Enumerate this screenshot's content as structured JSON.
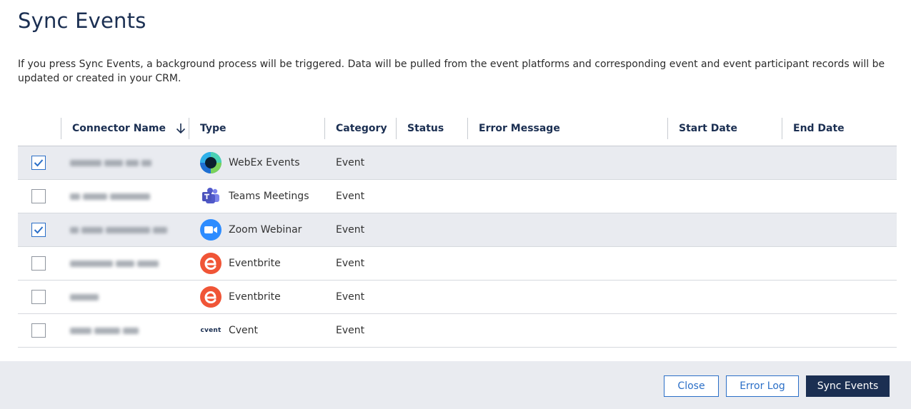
{
  "page": {
    "title": "Sync Events",
    "description": "If you press Sync Events, a background process will be triggered. Data will be pulled from the event platforms and corresponding event and event participant records will be updated or created in your CRM."
  },
  "table": {
    "columns": [
      "Connector Name",
      "Type",
      "Category",
      "Status",
      "Error Message",
      "Start Date",
      "End Date"
    ],
    "sort": {
      "column": "Connector Name",
      "direction": "descending",
      "icon": "arrow-down-icon"
    },
    "rows": [
      {
        "checked": true,
        "connector_name": "",
        "type": "WebEx Events",
        "type_icon": "webex-icon",
        "category": "Event",
        "status": "",
        "error_message": "",
        "start_date": "",
        "end_date": ""
      },
      {
        "checked": false,
        "connector_name": "",
        "type": "Teams Meetings",
        "type_icon": "teams-icon",
        "category": "Event",
        "status": "",
        "error_message": "",
        "start_date": "",
        "end_date": ""
      },
      {
        "checked": true,
        "connector_name": "",
        "type": "Zoom Webinar",
        "type_icon": "zoom-icon",
        "category": "Event",
        "status": "",
        "error_message": "",
        "start_date": "",
        "end_date": ""
      },
      {
        "checked": false,
        "connector_name": "",
        "type": "Eventbrite",
        "type_icon": "eventbrite-icon",
        "category": "Event",
        "status": "",
        "error_message": "",
        "start_date": "",
        "end_date": ""
      },
      {
        "checked": false,
        "connector_name": "",
        "type": "Eventbrite",
        "type_icon": "eventbrite-icon",
        "category": "Event",
        "status": "",
        "error_message": "",
        "start_date": "",
        "end_date": ""
      },
      {
        "checked": false,
        "connector_name": "",
        "type": "Cvent",
        "type_icon": "cvent-icon",
        "category": "Event",
        "status": "",
        "error_message": "",
        "start_date": "",
        "end_date": ""
      }
    ]
  },
  "icons": {
    "cvent_logo_text": "cvent"
  },
  "footer": {
    "close_label": "Close",
    "error_log_label": "Error Log",
    "sync_label": "Sync Events"
  },
  "colors": {
    "brand_navy": "#1b2f52",
    "accent_blue": "#2b6fc7",
    "selected_row": "#e9ebf0",
    "footer_bg": "#e9ebf0"
  }
}
